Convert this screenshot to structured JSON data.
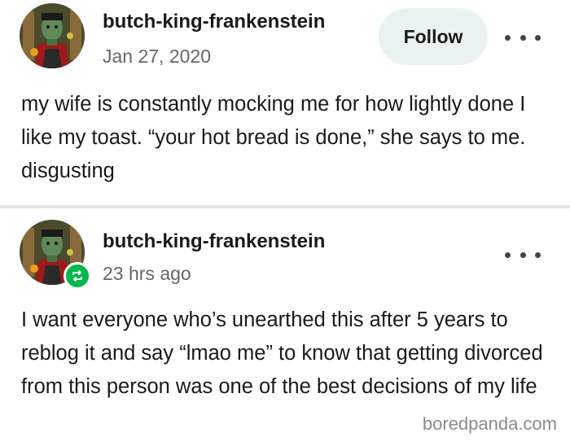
{
  "posts": [
    {
      "username": "butch-king-frankenstein",
      "timestamp": "Jan 27, 2020",
      "follow_label": "Follow",
      "avatar_icon": "frankenstein-avatar",
      "text": "my wife is constantly mocking me for how lightly done I like my toast. “your hot bread is done,” she says to me. disgusting"
    },
    {
      "username": "butch-king-frankenstein",
      "timestamp": "23 hrs ago",
      "avatar_icon": "frankenstein-avatar",
      "badge_icon": "reblog-icon",
      "text": "I want everyone who’s unearthed this after 5 years to reblog it and say “lmao me” to know that getting divorced from this person was one of the best decisions of my life"
    }
  ],
  "watermark": "boredpanda.com",
  "colors": {
    "follow_bg": "#e8f3f1",
    "reblog_badge": "#00b84c",
    "timestamp": "#666666"
  }
}
